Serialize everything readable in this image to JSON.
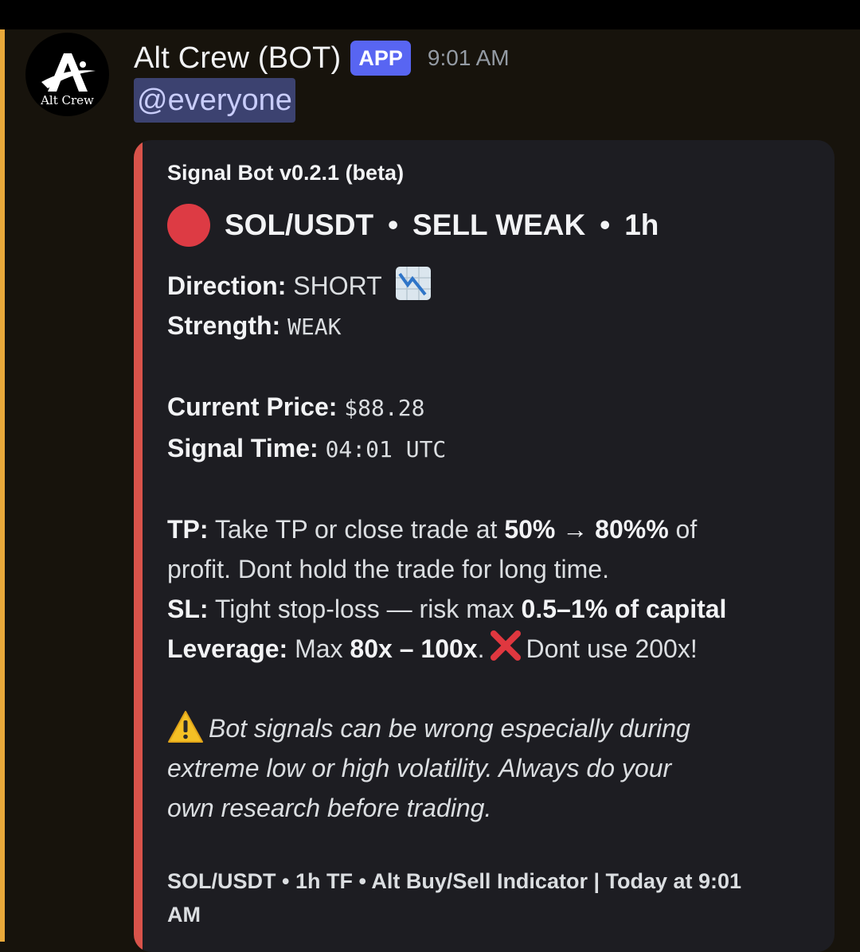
{
  "message": {
    "author": "Alt Crew (BOT)",
    "badge": "APP",
    "timestamp": "9:01 AM",
    "mention": "@everyone",
    "avatar_text": "Alt Crew"
  },
  "embed": {
    "author": "Signal Bot v0.2.1 (beta)",
    "title": {
      "pair": "SOL/USDT",
      "separator": "•",
      "signal": "SELL WEAK",
      "timeframe": "1h"
    },
    "direction_label": "Direction:",
    "direction_value": "SHORT",
    "strength_label": "Strength:",
    "strength_value": "WEAK",
    "price_label": "Current Price:",
    "price_value": "$88.28",
    "time_label": "Signal Time:",
    "time_value": "04:01 UTC",
    "tp_label": "TP:",
    "tp_text_1": "Take TP or close trade at",
    "tp_range": "50% → 80%%",
    "tp_text_2": "of",
    "tp_text_3": "profit. Dont hold the trade for long time.",
    "sl_label": "SL:",
    "sl_text": "Tight stop-loss — risk max",
    "sl_bold": "0.5–1% of capital",
    "leverage_label": "Leverage:",
    "leverage_text": "Max",
    "leverage_bold": "80x – 100x",
    "leverage_dot": ".",
    "leverage_warning": "Dont use 200x!",
    "warning_line_1": "Bot signals can be wrong especially during",
    "warning_line_2": "extreme low or high volatility. Always do your",
    "warning_line_3": "own research before trading.",
    "footer_line_1": "SOL/USDT • 1h TF • Alt Buy/Sell Indicator | Today at 9:01",
    "footer_line_2": "AM"
  },
  "colors": {
    "embed_accent": "#d9534a",
    "signal_circle": "#dd3b44",
    "badge": "#5865f2",
    "mention_highlight": "#e8a83a"
  },
  "icons": [
    "red-circle-icon",
    "chart-decreasing-icon",
    "cross-mark-icon",
    "warning-icon"
  ]
}
